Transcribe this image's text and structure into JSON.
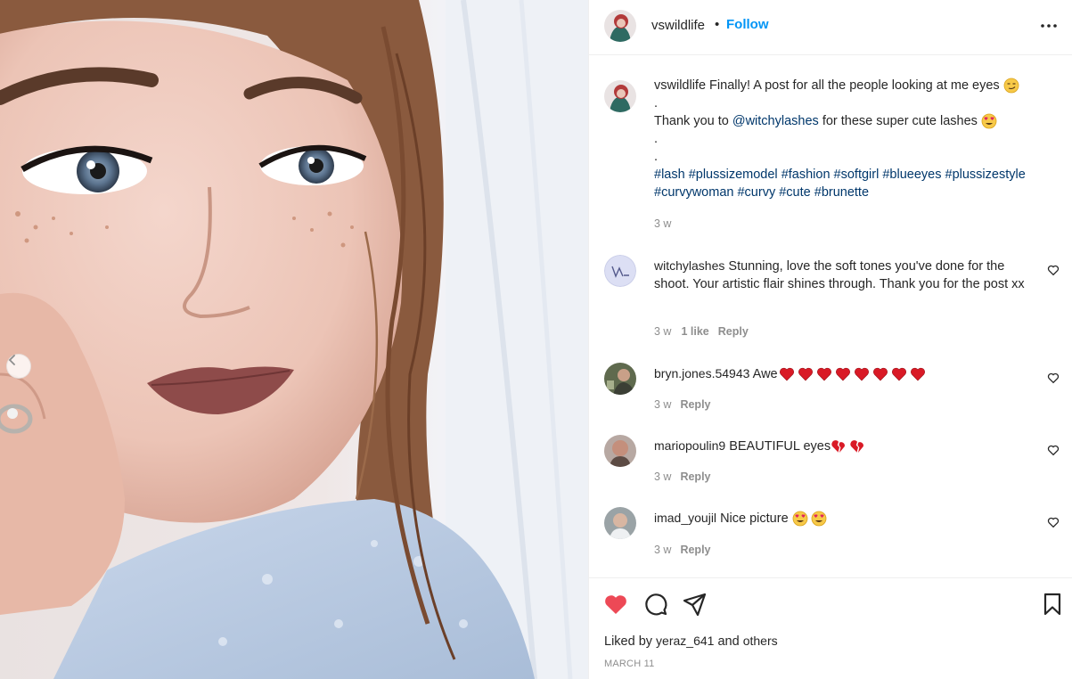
{
  "post": {
    "author": "vswildlife",
    "separator": "•",
    "follow_label": "Follow",
    "more_icon": "more-horizontal-icon"
  },
  "caption": {
    "username": "vswildlife",
    "line1": "Finally! A post for all the people looking at me eyes",
    "dot1": ".",
    "thank_prefix": "Thank you to",
    "mention": "@witchylashes",
    "thank_suffix": "for these super cute lashes",
    "dot2": ".",
    "dot3": ".",
    "hashtags": [
      "#lash",
      "#plussizemodel",
      "#fashion",
      "#softgirl",
      "#blueeyes",
      "#plussizestyle",
      "#curvywoman",
      "#curvy",
      "#cute",
      "#brunette"
    ],
    "time": "3 w"
  },
  "comments": [
    {
      "username": "witchylashes",
      "text": "Stunning, love the soft tones you've done for the shoot. Your artistic flair shines through. Thank you for the post xx",
      "time": "3 w",
      "likes": "1 like",
      "reply": "Reply"
    },
    {
      "username": "bryn.jones.54943",
      "text": "Awe",
      "hearts": 8,
      "time": "3 w",
      "reply": "Reply"
    },
    {
      "username": "mariopoulin9",
      "text": "BEAUTIFUL eyes",
      "time": "3 w",
      "reply": "Reply"
    },
    {
      "username": "imad_youjil",
      "text": "Nice picture",
      "time": "3 w",
      "reply": "Reply"
    }
  ],
  "footer": {
    "liked_prefix": "Liked by",
    "liked_user": "yeraz_641",
    "liked_and": "and",
    "liked_others": "others",
    "date": "MARCH 11"
  },
  "colors": {
    "accent": "#0095f6",
    "like_red": "#ed4956",
    "hashtag": "#00376b",
    "muted": "#8e8e8e"
  }
}
